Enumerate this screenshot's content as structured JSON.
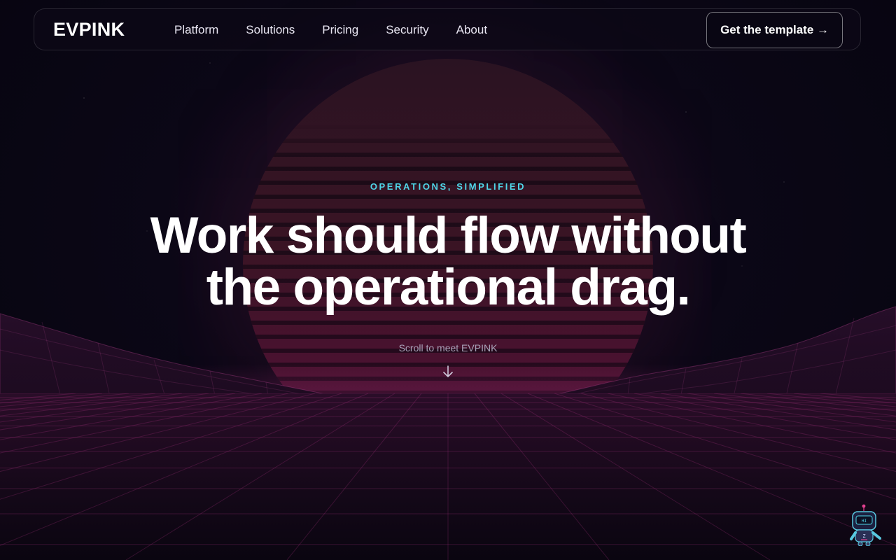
{
  "brand": {
    "name": "EVPINK"
  },
  "nav": {
    "links": [
      {
        "label": "Platform"
      },
      {
        "label": "Solutions"
      },
      {
        "label": "Pricing"
      },
      {
        "label": "Security"
      },
      {
        "label": "About"
      }
    ],
    "cta_label": "Get the template →"
  },
  "hero": {
    "eyebrow": "OPERATIONS, SIMPLIFIED",
    "headline_line1": "Work should flow without",
    "headline_line2": "the operational drag.",
    "scroll_hint": "Scroll to meet EVPINK"
  },
  "assistant": {
    "screen_text": "HI",
    "icon": "robot-assistant-icon"
  },
  "colors": {
    "background": "#06040f",
    "accent_cyan": "#4fd6e8",
    "accent_pink": "#c0307a",
    "text_primary": "#ffffff"
  }
}
